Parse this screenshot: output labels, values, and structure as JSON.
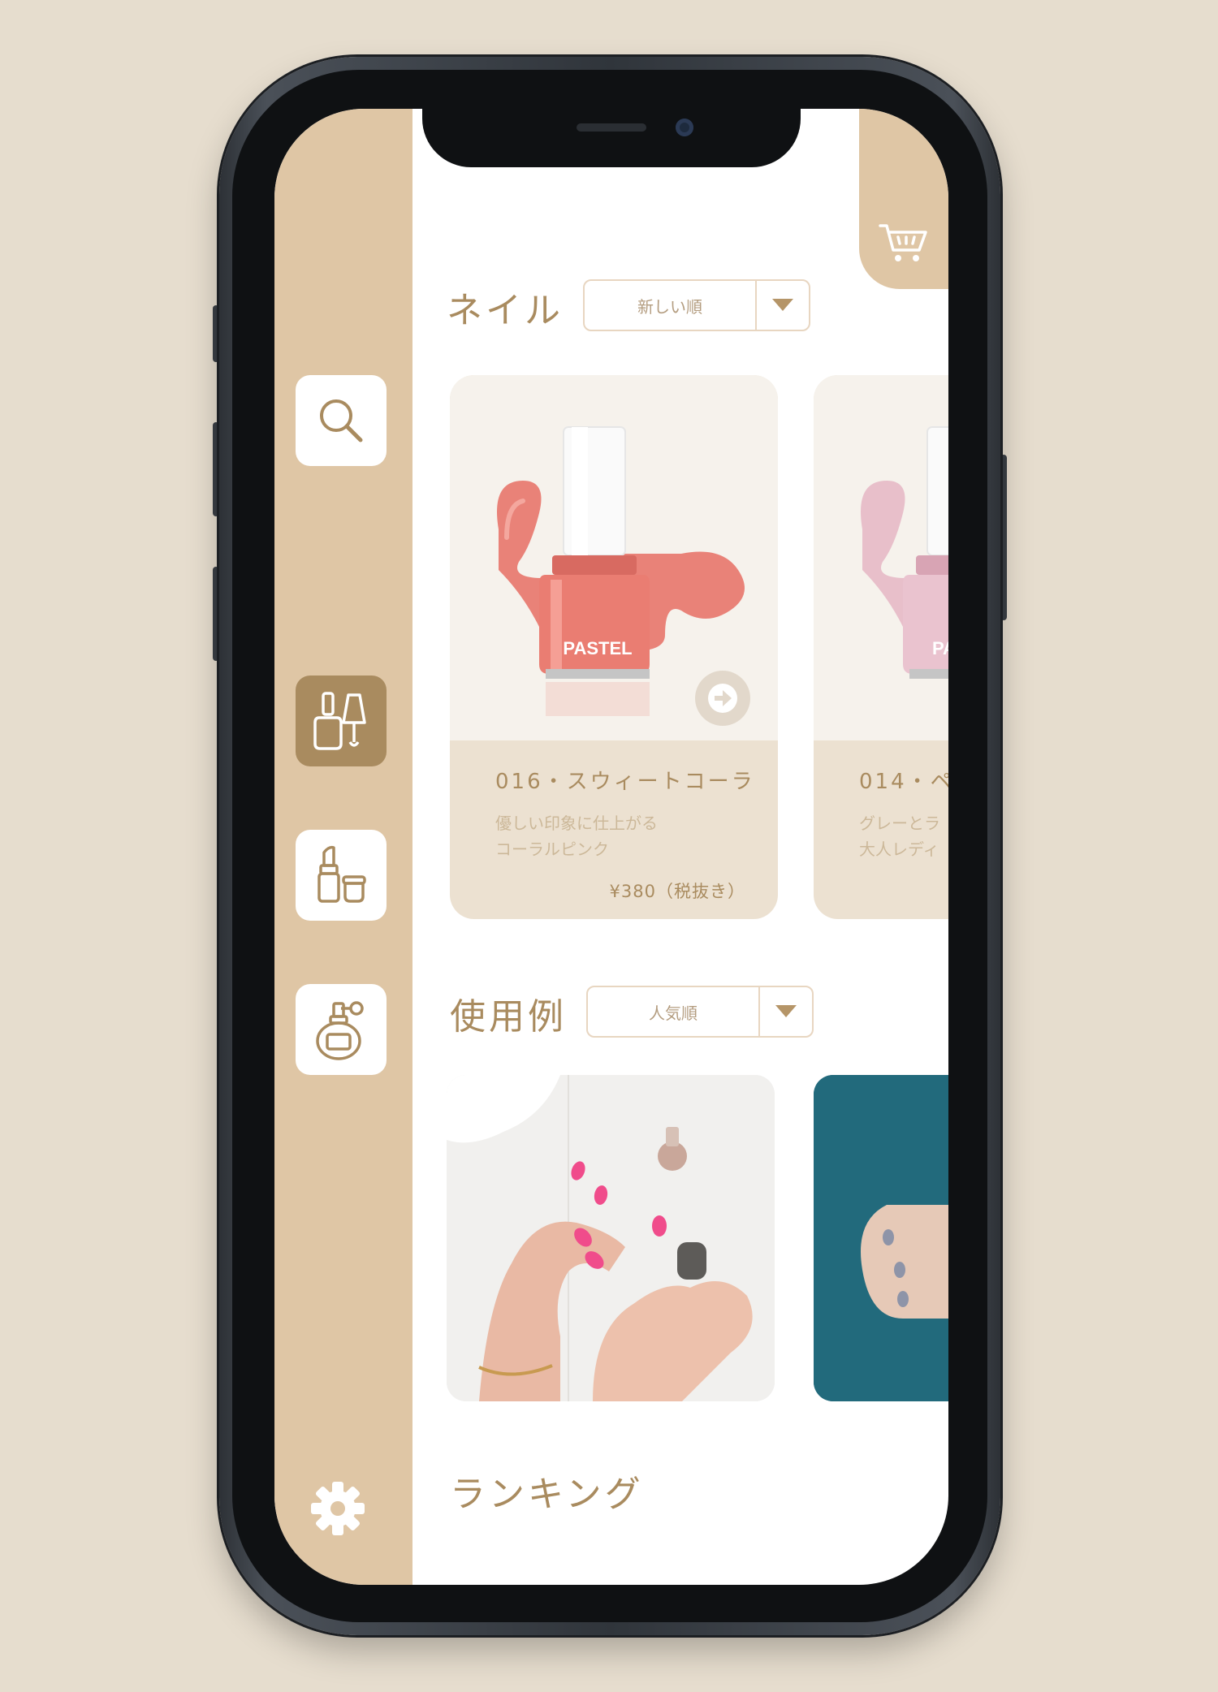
{
  "colors": {
    "background": "#e6ddce",
    "sidebar": "#dfc6a5",
    "accent": "#a98b5f",
    "card_bg": "#ece1d1",
    "nail_coral": "#e8766c",
    "nail_pink": "#e7b9c7",
    "photo_teal": "#226a7c"
  },
  "sidebar": {
    "items": [
      {
        "name": "search",
        "icon": "search-icon"
      },
      {
        "name": "nail-polish",
        "icon": "nail-polish-icon",
        "active": true
      },
      {
        "name": "lipstick-cream",
        "icon": "lipstick-cream-icon"
      },
      {
        "name": "perfume",
        "icon": "perfume-icon"
      }
    ],
    "settings_icon": "gear-icon"
  },
  "cart": {
    "icon": "cart-icon"
  },
  "nail_section": {
    "title": "ネイル",
    "sort_value": "新しい順",
    "products": [
      {
        "name": "016・スウィートコーラ",
        "desc_line1": "優しい印象に仕上がる",
        "desc_line2": "コーラルピンク",
        "price": "¥380（税抜き）",
        "bottle_label": "PASTEL",
        "color": "#e8766c"
      },
      {
        "name": "014・ペ",
        "desc_line1": "グレーとラ",
        "desc_line2": "大人レディ",
        "bottle_label": "PAS",
        "color": "#e7b9c7"
      }
    ]
  },
  "example_section": {
    "title": "使用例",
    "sort_value": "人気順"
  },
  "ranking_section": {
    "title": "ランキング"
  }
}
